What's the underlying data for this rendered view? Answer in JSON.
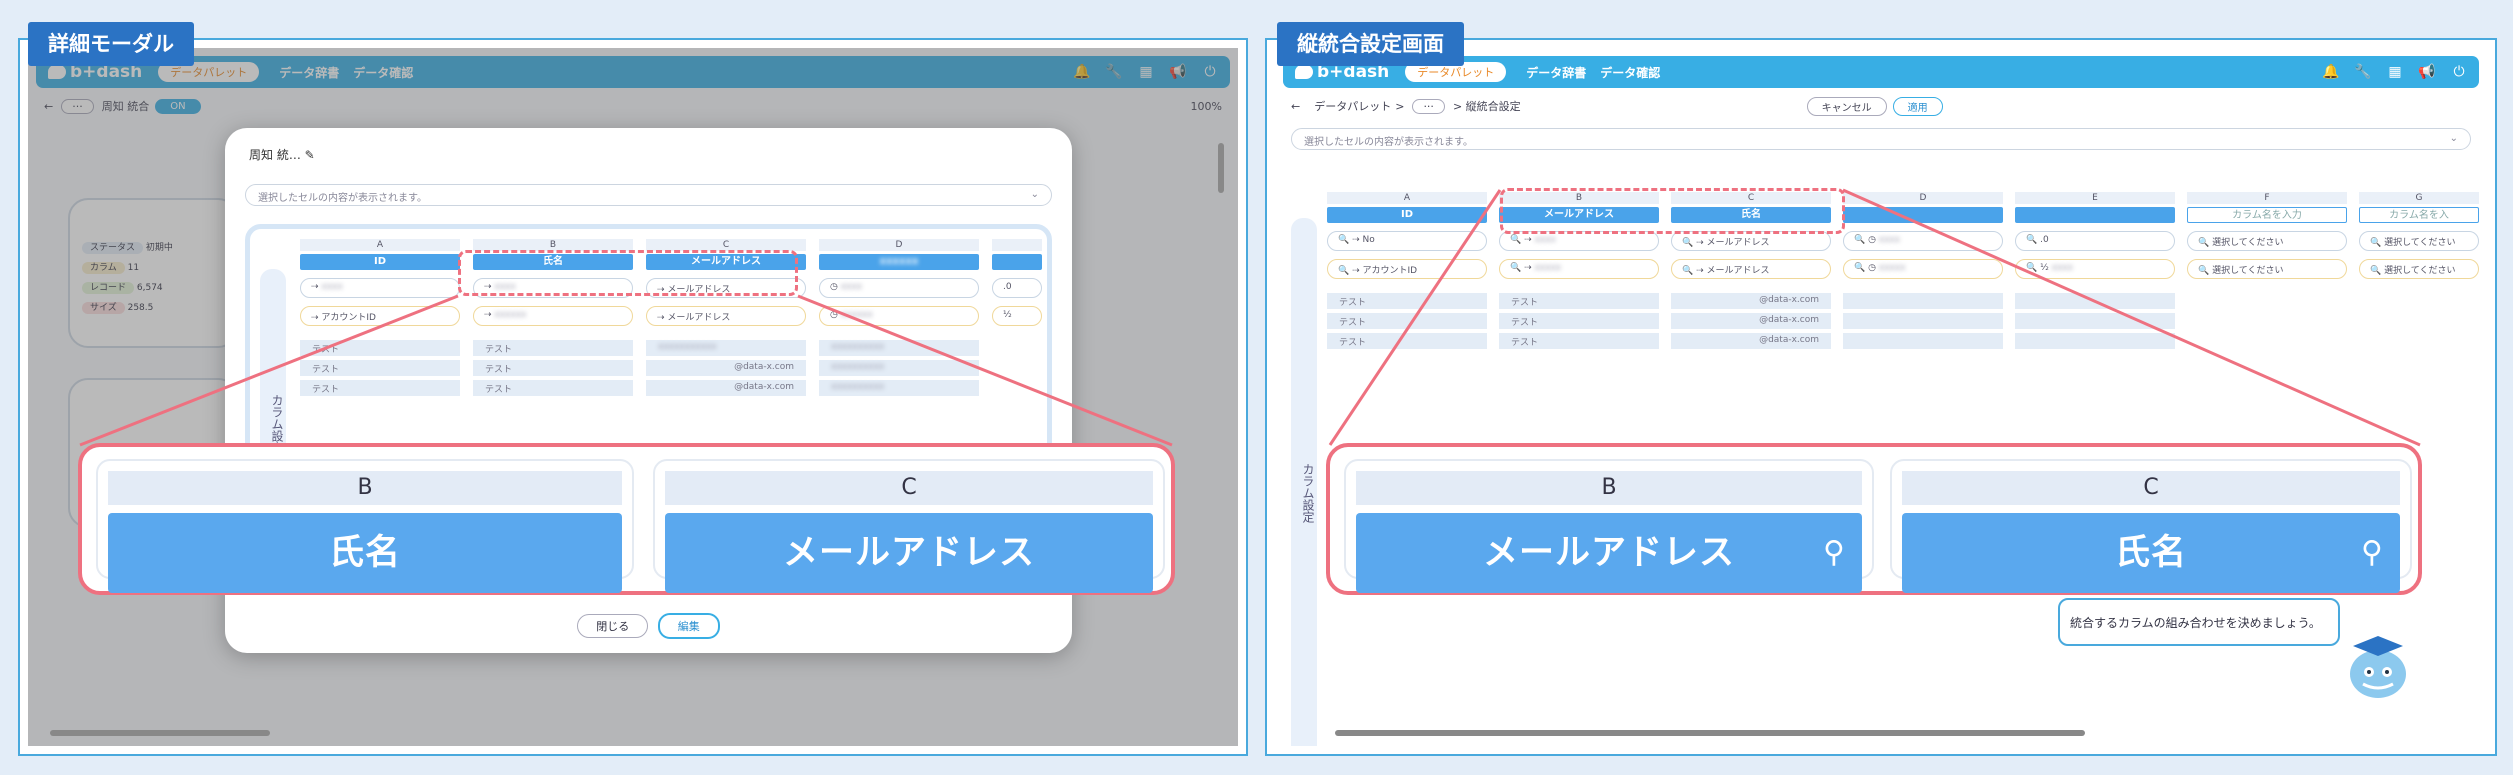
{
  "left_panel": {
    "title": "詳細モーダル",
    "app": {
      "logo": "b+dash",
      "palette_pill": "データパレット",
      "nav": [
        "データ辞書",
        "データ確認"
      ],
      "breadcrumb": "周知 統合",
      "toggle": "ON",
      "zoom": "100%"
    },
    "cards": [
      {
        "label": "ステータス",
        "value": "初期中"
      },
      {
        "label": "カラム",
        "value": "11"
      },
      {
        "label": "レコード",
        "value": "6,574"
      },
      {
        "label": "サイズ",
        "value": "258.5"
      }
    ],
    "modal": {
      "title": "周知 統…",
      "search_placeholder": "選択したセルの内容が表示されます。",
      "side_tab": "カラム設定",
      "columns": [
        {
          "letter": "A",
          "head": "ID",
          "field1": "",
          "field2": "アカウントID",
          "cells": [
            "テスト",
            "テスト",
            "テスト"
          ]
        },
        {
          "letter": "B",
          "head": "氏名",
          "field1": "",
          "field2": "",
          "cells": [
            "テスト",
            "テスト",
            "テスト"
          ]
        },
        {
          "letter": "C",
          "head": "メールアドレス",
          "field1": "メールアドレス",
          "field2": "メールアドレス",
          "cells": [
            "",
            "@data-x.com",
            "@data-x.com"
          ]
        },
        {
          "letter": "D",
          "head": "",
          "field1": "",
          "field2": "",
          "cells": [
            "",
            "",
            ""
          ]
        },
        {
          "letter": "",
          "head": "",
          "field1": ".0",
          "field2": "",
          "cells": [
            "",
            "",
            ""
          ]
        }
      ],
      "close_button": "閉じる",
      "edit_button": "編集"
    },
    "zoom": [
      {
        "letter": "B",
        "head": "氏名"
      },
      {
        "letter": "C",
        "head": "メールアドレス"
      }
    ]
  },
  "right_panel": {
    "title": "縦統合設定画面",
    "app": {
      "logo": "b+dash",
      "palette_pill": "データパレット",
      "nav": [
        "データ辞書",
        "データ確認"
      ],
      "breadcrumb_root": "データパレット",
      "breadcrumb_leaf": "縦統合設定",
      "cancel_button": "キャンセル",
      "apply_button": "適用",
      "search_placeholder": "選択したセルの内容が表示されます。",
      "side_tab": "カラム設定"
    },
    "columns": [
      {
        "letter": "A",
        "head": "ID",
        "f1": "No",
        "f2": "アカウントID",
        "cells": [
          "テスト",
          "テスト",
          "テスト"
        ]
      },
      {
        "letter": "B",
        "head": "メールアドレス",
        "f1": "",
        "f2": "",
        "cells": [
          "テスト",
          "テスト",
          "テスト"
        ]
      },
      {
        "letter": "C",
        "head": "氏名",
        "f1": "メールアドレス",
        "f2": "メールアドレス",
        "cells": [
          "@data-x.com",
          "@data-x.com",
          "@data-x.com"
        ]
      },
      {
        "letter": "D",
        "head": "",
        "f1": "",
        "f2": "",
        "cells": [
          "",
          "",
          ""
        ]
      },
      {
        "letter": "E",
        "head": "",
        "f1": ".0",
        "f2": "",
        "cells": [
          "",
          "",
          ""
        ]
      },
      {
        "letter": "F",
        "head": "カラム名を入力",
        "f1": "選択してください",
        "f2": "選択してください",
        "cells": [
          "",
          "",
          ""
        ]
      },
      {
        "letter": "G",
        "head": "カラム名を入",
        "f1": "選択してください",
        "f2": "選択してください",
        "cells": [
          "",
          "",
          ""
        ]
      }
    ],
    "hint": "統合するカラムの組み合わせを決めましょう。",
    "zoom": [
      {
        "letter": "B",
        "head": "メールアドレス"
      },
      {
        "letter": "C",
        "head": "氏名"
      }
    ]
  },
  "colors": {
    "accent": "#38aee4",
    "header_blue": "#4aa3ea",
    "highlight_red": "#ee7180",
    "panel_title": "#2b73c4"
  }
}
